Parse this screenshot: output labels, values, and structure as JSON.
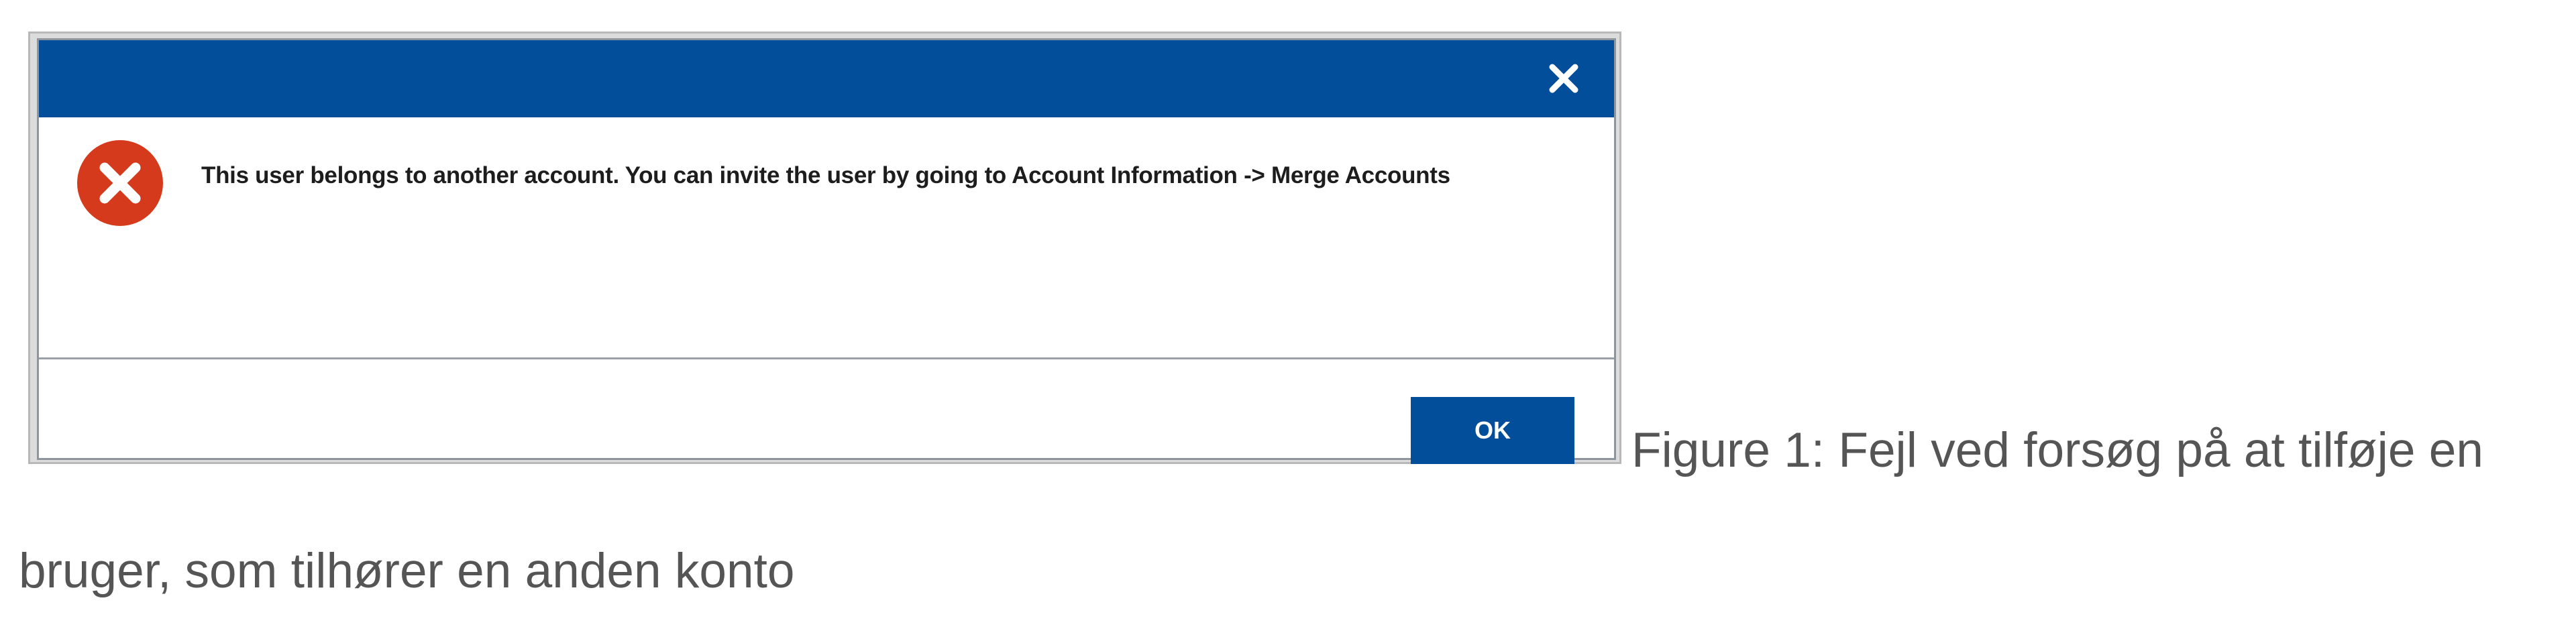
{
  "dialog": {
    "title": "",
    "close_icon": "close-icon",
    "status_icon": "error-icon",
    "message": "This user belongs to another account. You can invite the user by going to Account Information -> Merge Accounts",
    "ok_label": "OK"
  },
  "caption": {
    "line1": "Figure 1: Fejl ved forsøg på at tilføje en",
    "line2": "bruger, som tilhører en anden konto"
  },
  "colors": {
    "header": "#034e9b",
    "button": "#034e9b",
    "error": "#d63a1c",
    "caption_text": "#555555"
  }
}
